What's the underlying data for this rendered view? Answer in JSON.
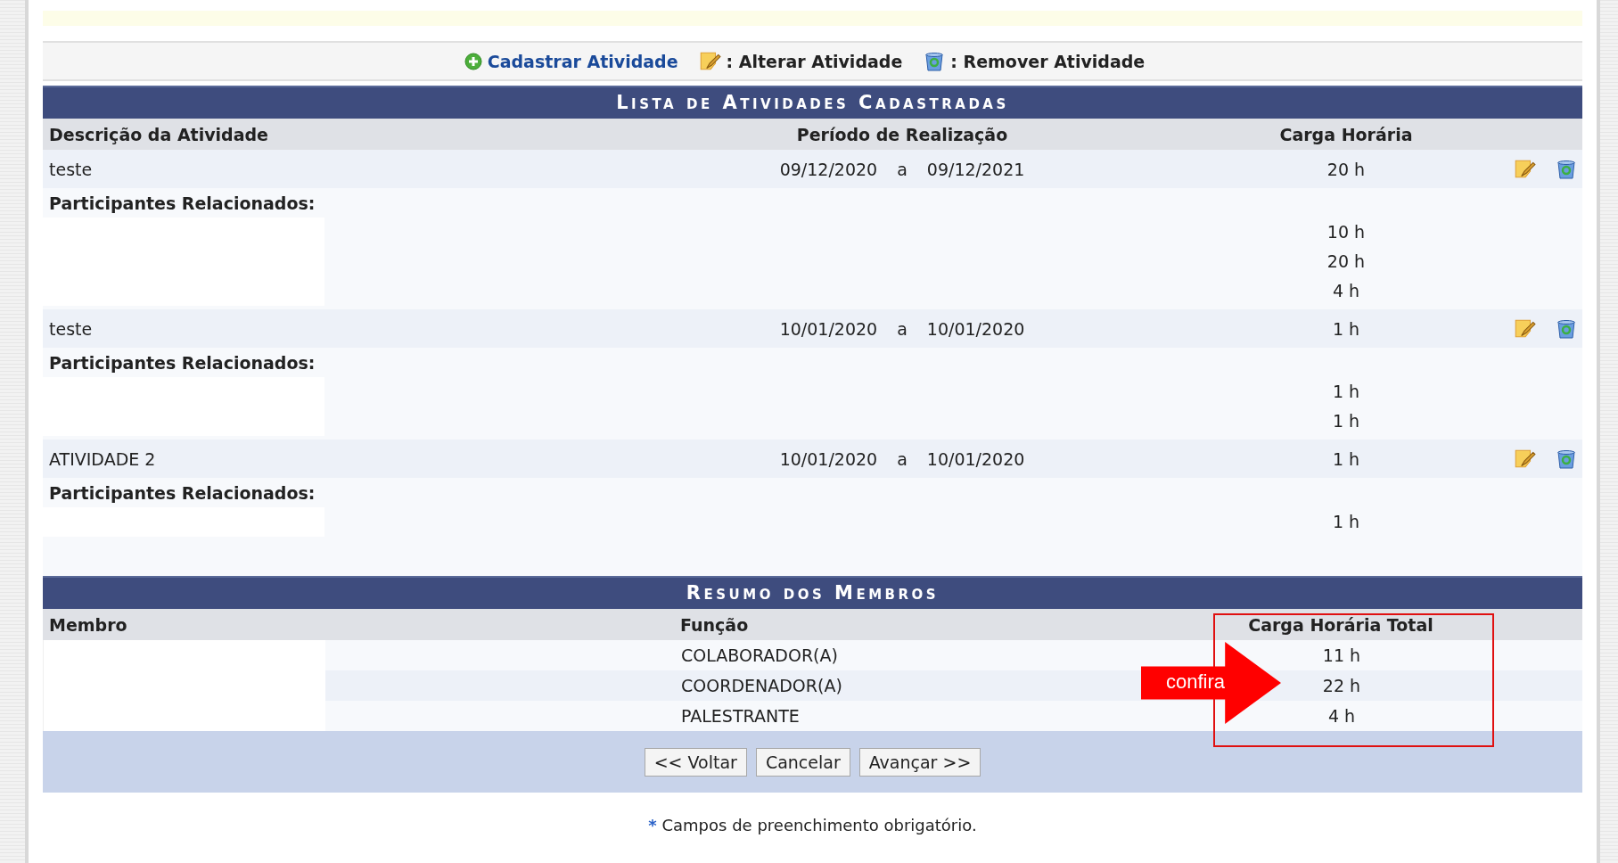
{
  "toolbar": {
    "add_label": "Cadastrar Atividade",
    "edit_label": ": Alterar Atividade",
    "remove_label": ": Remover Atividade"
  },
  "activities_table": {
    "title": "Lista de Atividades Cadastradas",
    "columns": [
      "Descrição da Atividade",
      "Período de Realização",
      "Carga Horária"
    ],
    "rows": [
      {
        "description": "teste",
        "start": "09/12/2020",
        "separator": "a",
        "end": "09/12/2021",
        "hours": "20 h",
        "participants_label": "Participantes Relacionados:",
        "participant_hours": [
          "10 h",
          "20 h",
          "4 h"
        ]
      },
      {
        "description": "teste",
        "start": "10/01/2020",
        "separator": "a",
        "end": "10/01/2020",
        "hours": "1 h",
        "participants_label": "Participantes Relacionados:",
        "participant_hours": [
          "1 h",
          "1 h"
        ]
      },
      {
        "description": "ATIVIDADE 2",
        "start": "10/01/2020",
        "separator": "a",
        "end": "10/01/2020",
        "hours": "1 h",
        "participants_label": "Participantes Relacionados:",
        "participant_hours": [
          "1 h"
        ]
      }
    ]
  },
  "members_table": {
    "title": "Resumo dos Membros",
    "columns": [
      "Membro",
      "Função",
      "Carga Horária Total"
    ],
    "rows": [
      {
        "role": "COLABORADOR(A)",
        "total": "11 h"
      },
      {
        "role": "COORDENADOR(A)",
        "total": "22 h"
      },
      {
        "role": "PALESTRANTE",
        "total": "4 h"
      }
    ]
  },
  "buttons": [
    "<< Voltar",
    "Cancelar",
    "Avançar >>"
  ],
  "footnote": {
    "mark": "*",
    "text": "Campos de preenchimento obrigatório."
  },
  "annotation": {
    "label": "confira"
  }
}
